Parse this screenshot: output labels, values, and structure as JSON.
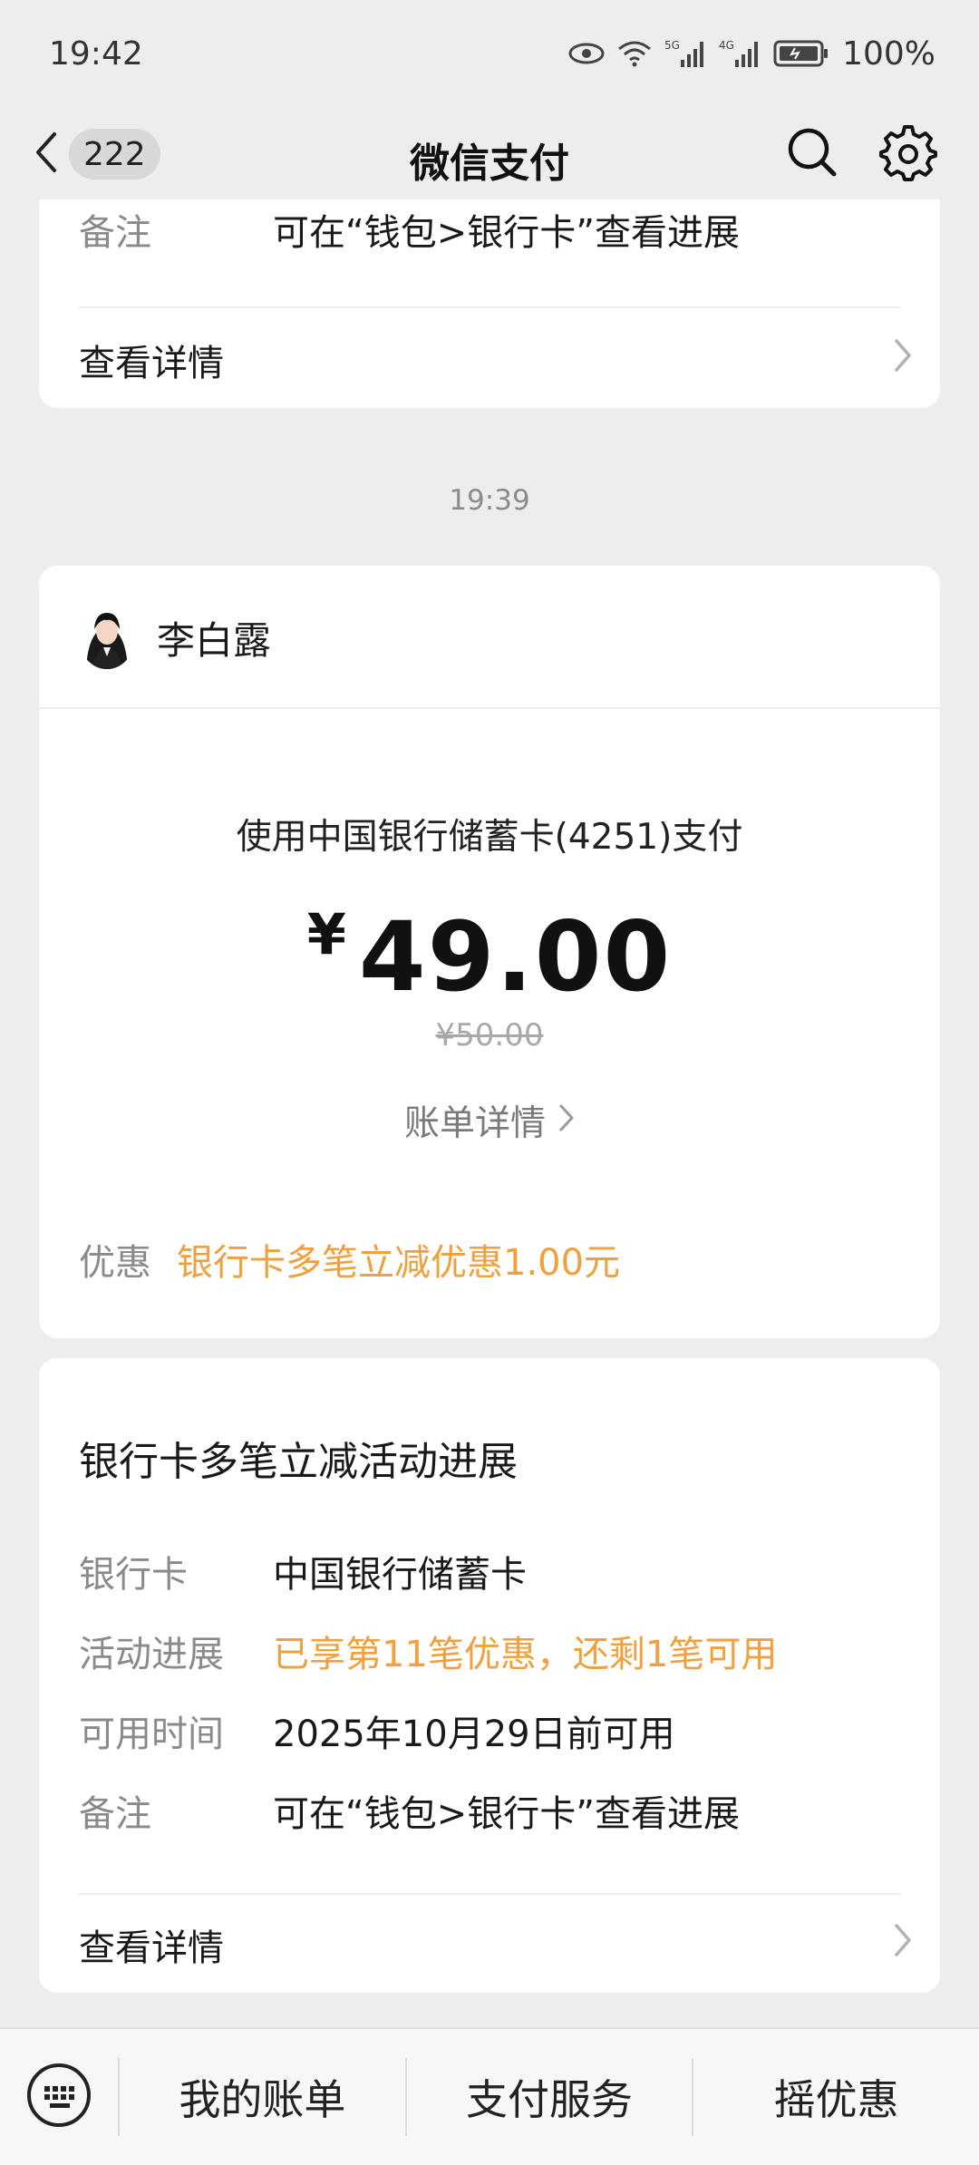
{
  "status": {
    "time": "19:42",
    "battery": "100%",
    "signal1": "5G",
    "signal2": "4G"
  },
  "header": {
    "unread_count": "222",
    "title": "微信支付"
  },
  "top_card": {
    "note_label": "备注",
    "note_value": "可在“钱包>银行卡”查看进展",
    "details_link": "查看详情"
  },
  "timestamp": "19:39",
  "payment": {
    "merchant": "李白露",
    "method": "使用中国银行储蓄卡(4251)支付",
    "currency": "¥",
    "amount": "49.00",
    "original_amount": "¥50.00",
    "bill_details": "账单详情",
    "discount_label": "优惠",
    "discount_value": "银行卡多笔立减优惠1.00元"
  },
  "progress": {
    "title": "银行卡多笔立减活动进展",
    "rows": [
      {
        "label": "银行卡",
        "value": "中国银行储蓄卡"
      },
      {
        "label": "活动进展",
        "value": "已享第11笔优惠，还剩1笔可用"
      },
      {
        "label": "可用时间",
        "value": "2025年10月29日前可用"
      },
      {
        "label": "备注",
        "value": "可在“钱包>银行卡”查看进展"
      }
    ],
    "details_link": "查看详情"
  },
  "bottom_menu": {
    "items": [
      "我的账单",
      "支付服务",
      "摇优惠"
    ]
  },
  "colors": {
    "accent_orange": "#f0a03c",
    "background": "#ededed"
  }
}
